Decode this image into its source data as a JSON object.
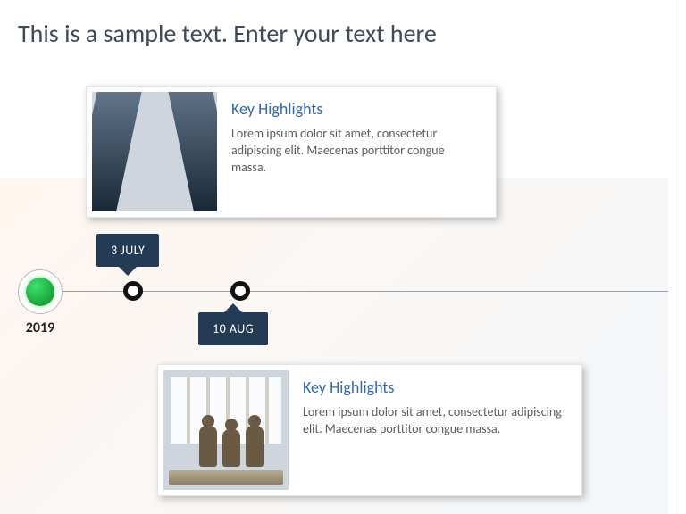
{
  "page_title": "This is a sample text. Enter your text here",
  "timeline": {
    "start_year": "2019",
    "events": [
      {
        "date_label": "3 JULY",
        "card": {
          "title": "Key Highlights",
          "body": "Lorem ipsum dolor sit amet, consectetur adipiscing elit. Maecenas porttitor congue massa.",
          "image_name": "skyscrapers-looking-up"
        }
      },
      {
        "date_label": "10 AUG",
        "card": {
          "title": "Key Highlights",
          "body": "Lorem ipsum dolor sit amet, consectetur adipiscing elit. Maecenas porttitor congue massa.",
          "image_name": "business-meeting-bright-room"
        }
      }
    ]
  },
  "colors": {
    "title_text": "#3d4a5c",
    "tag_bg": "#243b56",
    "accent_green": "#17a637",
    "card_title": "#2f67b2"
  }
}
